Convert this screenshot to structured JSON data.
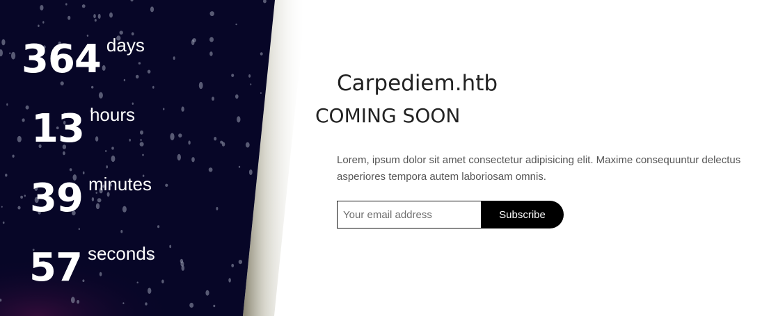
{
  "countdown": [
    {
      "value": "364",
      "unit": "days"
    },
    {
      "value": "13",
      "unit": "hours"
    },
    {
      "value": "39",
      "unit": "minutes"
    },
    {
      "value": "57",
      "unit": "seconds"
    }
  ],
  "site": {
    "title": "Carpediem.htb",
    "subtitle": "COMING SOON",
    "description": "Lorem, ipsum dolor sit amet consectetur adipisicing elit. Maxime consequuntur delectus asperiores tempora autem laboriosam omnis."
  },
  "subscribe": {
    "placeholder": "Your email address",
    "button_label": "Subscribe"
  },
  "colors": {
    "panel_background": "#070627",
    "text_dark": "#222222",
    "button": "#000000"
  }
}
